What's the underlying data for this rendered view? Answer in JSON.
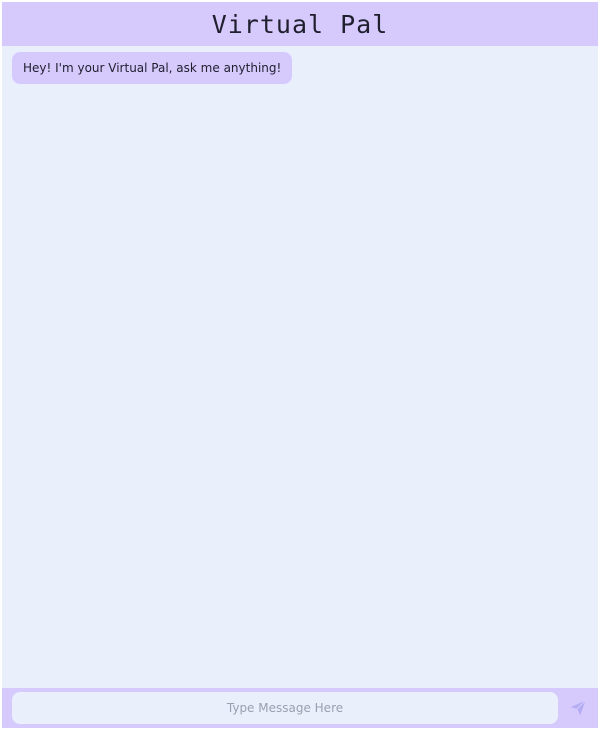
{
  "header": {
    "title": "Virtual Pal"
  },
  "messages": [
    {
      "sender": "bot",
      "text": "Hey! I'm your Virtual Pal, ask me anything!"
    }
  ],
  "composer": {
    "placeholder": "Type Message Here",
    "value": "",
    "send_icon": "send-icon"
  },
  "colors": {
    "accent": "#d6cafd",
    "background": "#eaeffc",
    "send_icon": "#b4acf3"
  }
}
